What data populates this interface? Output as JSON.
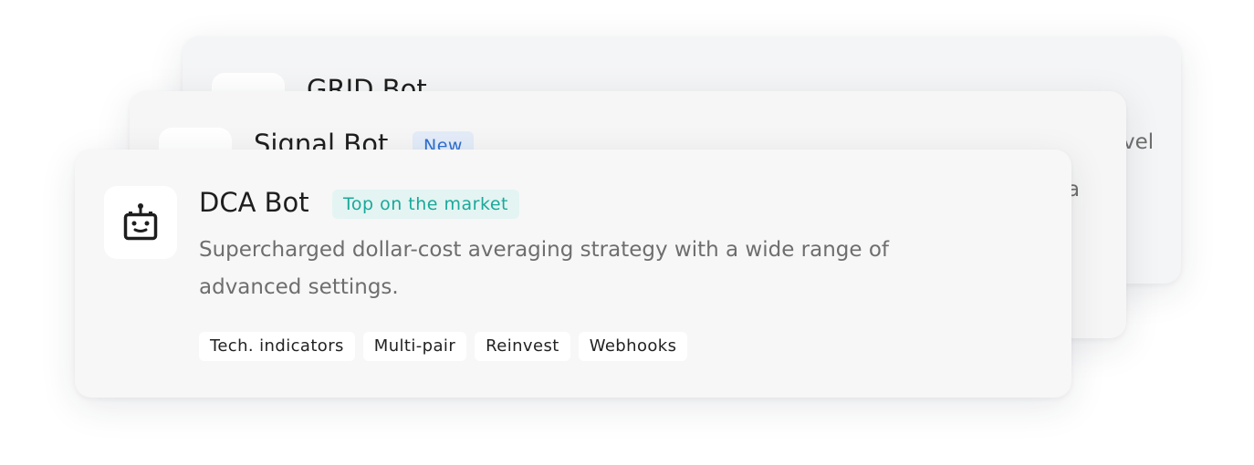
{
  "cards": [
    {
      "title": "GRID Bot",
      "desc_fragment": "vel"
    },
    {
      "title": "Signal Bot",
      "badge": "New",
      "badge_color": "#2f6fd0",
      "badge_bg": "#e3ecf8",
      "desc_fragment": "a"
    },
    {
      "title": "DCA Bot",
      "badge": "Top on the market",
      "badge_color": "#1aa89a",
      "badge_bg": "#e3f4f2",
      "icon": "robot-icon",
      "description": "Supercharged dollar-cost averaging strategy with a wide range of advanced settings.",
      "tags": [
        "Tech. indicators",
        "Multi-pair",
        "Reinvest",
        "Webhooks"
      ]
    }
  ]
}
